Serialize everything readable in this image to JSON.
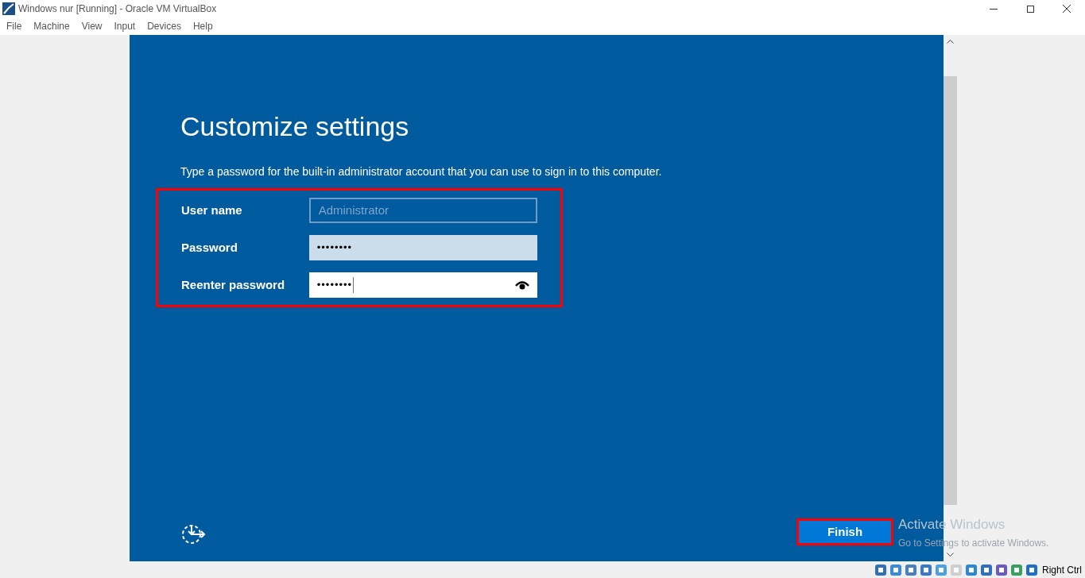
{
  "window": {
    "title": "Windows nur [Running] - Oracle VM VirtualBox"
  },
  "menu": [
    "File",
    "Machine",
    "View",
    "Input",
    "Devices",
    "Help"
  ],
  "setup": {
    "heading": "Customize settings",
    "instruction": "Type a password for the built-in administrator account that you can use to sign in to this computer.",
    "highlighted": true,
    "fields": [
      {
        "label": "User name",
        "kind": "text",
        "value": "Administrator",
        "disabled": true,
        "focused": false
      },
      {
        "label": "Password",
        "kind": "password",
        "value": "••••••••",
        "disabled": false,
        "focused": false
      },
      {
        "label": "Reenter password",
        "kind": "password",
        "value": "••••••••",
        "disabled": false,
        "focused": true
      }
    ],
    "finish": {
      "label": "Finish",
      "highlighted": true
    }
  },
  "activation": {
    "title": "Activate Windows",
    "hint": "Go to Settings to activate Windows."
  },
  "status_bar": {
    "host_key": "Right Ctrl"
  }
}
